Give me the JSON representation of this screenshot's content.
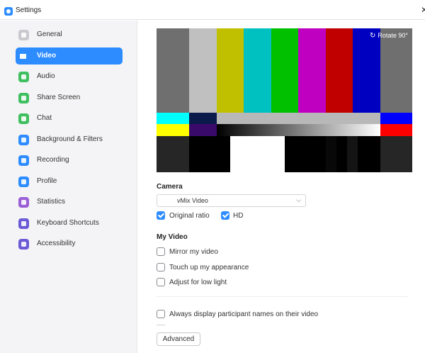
{
  "window": {
    "title": "Settings",
    "close_glyph": "✕"
  },
  "sidebar": {
    "items": [
      {
        "label": "General",
        "icon": "gear-icon",
        "color": "#c9c9cf",
        "active": false
      },
      {
        "label": "Video",
        "icon": "video-camera-icon",
        "color": "#ffffff",
        "active": true
      },
      {
        "label": "Audio",
        "icon": "headphones-icon",
        "color": "#3fbf5f",
        "active": false
      },
      {
        "label": "Share Screen",
        "icon": "share-screen-icon",
        "color": "#3fbf5f",
        "active": false
      },
      {
        "label": "Chat",
        "icon": "chat-bubble-icon",
        "color": "#3fbf5f",
        "active": false
      },
      {
        "label": "Background & Filters",
        "icon": "background-icon",
        "color": "#2d8cff",
        "active": false
      },
      {
        "label": "Recording",
        "icon": "record-icon",
        "color": "#2d8cff",
        "active": false
      },
      {
        "label": "Profile",
        "icon": "profile-icon",
        "color": "#2d8cff",
        "active": false
      },
      {
        "label": "Statistics",
        "icon": "statistics-icon",
        "color": "#9b5fd6",
        "active": false
      },
      {
        "label": "Keyboard Shortcuts",
        "icon": "keyboard-icon",
        "color": "#6b5bd6",
        "active": false
      },
      {
        "label": "Accessibility",
        "icon": "accessibility-icon",
        "color": "#6b5bd6",
        "active": false
      }
    ]
  },
  "preview": {
    "rotate_label": "Rotate 90°",
    "rotate_icon": "rotate-icon"
  },
  "camera": {
    "label": "Camera",
    "selected": "vMix Video"
  },
  "options": {
    "original_ratio": {
      "label": "Original ratio",
      "checked": true
    },
    "hd": {
      "label": "HD",
      "checked": true
    }
  },
  "my_video": {
    "label": "My Video",
    "mirror": {
      "label": "Mirror my video",
      "checked": false
    },
    "touch_up": {
      "label": "Touch up my appearance",
      "checked": false
    },
    "low_light": {
      "label": "Adjust for low light",
      "checked": false
    }
  },
  "always_display": {
    "label": "Always display participant names on their video",
    "checked": false
  },
  "advanced_button": "Advanced",
  "colors": {
    "accent": "#2d8cff",
    "sidebar_bg": "#f4f4f6"
  }
}
